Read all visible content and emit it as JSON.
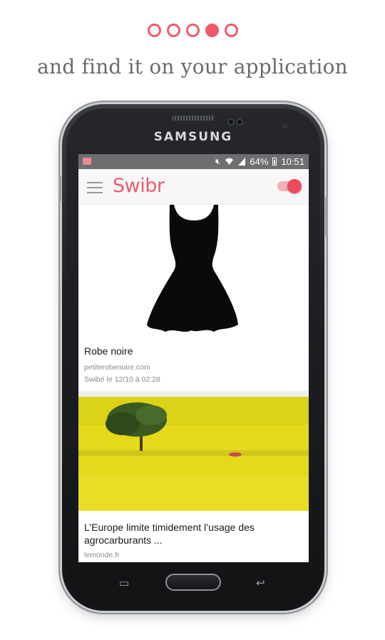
{
  "pager": {
    "total": 5,
    "active_index": 3
  },
  "headline": "and find it on your application",
  "phone": {
    "brand": "SAMSUNG"
  },
  "statusbar": {
    "battery": "64%",
    "time": "10:51",
    "icons": [
      "mute-icon",
      "wifi-icon",
      "signal-icon",
      "battery-icon"
    ]
  },
  "appbar": {
    "logo": "Swibr",
    "menu_icon": "menu-icon",
    "toggle_on": true
  },
  "cards": [
    {
      "title": "Robe noire",
      "source": "petiterobenoire.com",
      "swiped": "Swibé le 12/10 à 02:28",
      "image": "black-dress"
    },
    {
      "title": "L’Europe limite timidement l’usage des agrocarburants ...",
      "source": "lemonde.fr",
      "image": "yellow-field-tree"
    }
  ],
  "colors": {
    "accent": "#ef5b6c",
    "headline": "#6b6b6b",
    "statusbar": "#6d6e70"
  }
}
